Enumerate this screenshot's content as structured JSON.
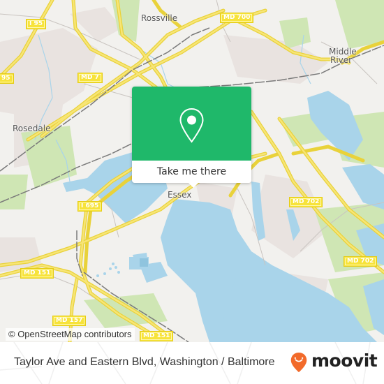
{
  "map": {
    "places": [
      {
        "id": "rossville",
        "label": "Rossville"
      },
      {
        "id": "middle-river-1",
        "label": "Middle"
      },
      {
        "id": "middle-river-2",
        "label": "River"
      },
      {
        "id": "rosedale",
        "label": "Rosedale"
      },
      {
        "id": "essex",
        "label": "Essex"
      }
    ],
    "road_shields": [
      {
        "id": "i95-top",
        "label": "I 95"
      },
      {
        "id": "i95-left",
        "label": "95"
      },
      {
        "id": "md7",
        "label": "MD 7"
      },
      {
        "id": "md700",
        "label": "MD 700"
      },
      {
        "id": "i695",
        "label": "I 695"
      },
      {
        "id": "md702-a",
        "label": "MD 702"
      },
      {
        "id": "md702-b",
        "label": "MD 702"
      },
      {
        "id": "md151-a",
        "label": "MD 151"
      },
      {
        "id": "md151-b",
        "label": "MD 151"
      },
      {
        "id": "md157",
        "label": "MD 157"
      }
    ],
    "colors": {
      "land": "#f2f1ee",
      "water": "#a9d4ea",
      "park": "#cfe6b4",
      "residential": "#e8e1df",
      "road": "#f7e33a",
      "rail": "#777777"
    }
  },
  "popup": {
    "icon": "map-pin-icon",
    "button_label": "Take me there",
    "accent_color": "#1fb86a"
  },
  "attribution": "© OpenStreetMap contributors",
  "footer": {
    "caption": "Taylor Ave and Eastern Blvd, Washington / Baltimore",
    "brand_name": "moovit",
    "brand_icon": "moovit-logo-icon",
    "brand_color": "#f26a2a"
  }
}
